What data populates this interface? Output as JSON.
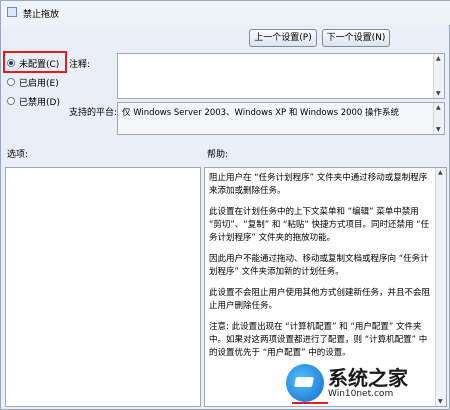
{
  "window": {
    "title": "禁止拖放",
    "title_icon": "policy-icon"
  },
  "nav": {
    "prev_label": "上一个设置(P)",
    "next_label": "下一个设置(N)"
  },
  "state": {
    "options": [
      {
        "id": "not_configured",
        "label": "未配置(C)",
        "checked": true
      },
      {
        "id": "enabled",
        "label": "已启用(E)",
        "checked": false
      },
      {
        "id": "disabled",
        "label": "已禁用(D)",
        "checked": false
      }
    ],
    "highlight_color": "#e02020"
  },
  "comment": {
    "label": "注释:",
    "value": ""
  },
  "platform": {
    "label": "支持的平台:",
    "value": "仅 Windows Server 2003、Windows XP 和 Windows 2000 操作系统"
  },
  "options_pane": {
    "label": "选项:"
  },
  "help": {
    "label": "帮助:",
    "paragraphs": [
      "阻止用户在 “任务计划程序” 文件夹中通过移动或复制程序来添加或删除任务。",
      "此设置在计划任务中的上下文菜单和 “编辑” 菜单中禁用 “剪切”、“复制” 和 “粘贴” 快捷方式项目。同时还禁用 “任务计划程序” 文件夹的拖放功能。",
      "因此用户不能通过拖动、移动或复制文档或程序向 “任务计划程序” 文件夹添加新的计划任务。",
      "此设置不会阻止用户使用其他方式创建新任务，并且不会阻止用户删除任务。",
      "注意: 此设置出现在 “计算机配置” 和 “用户配置” 文件夹中。如果对这两项设置都进行了配置，则 “计算机配置” 中的设置优先于 “用户配置” 中的设置。"
    ]
  },
  "watermark": {
    "main": "系统之家",
    "sub": "Win10net.com"
  }
}
